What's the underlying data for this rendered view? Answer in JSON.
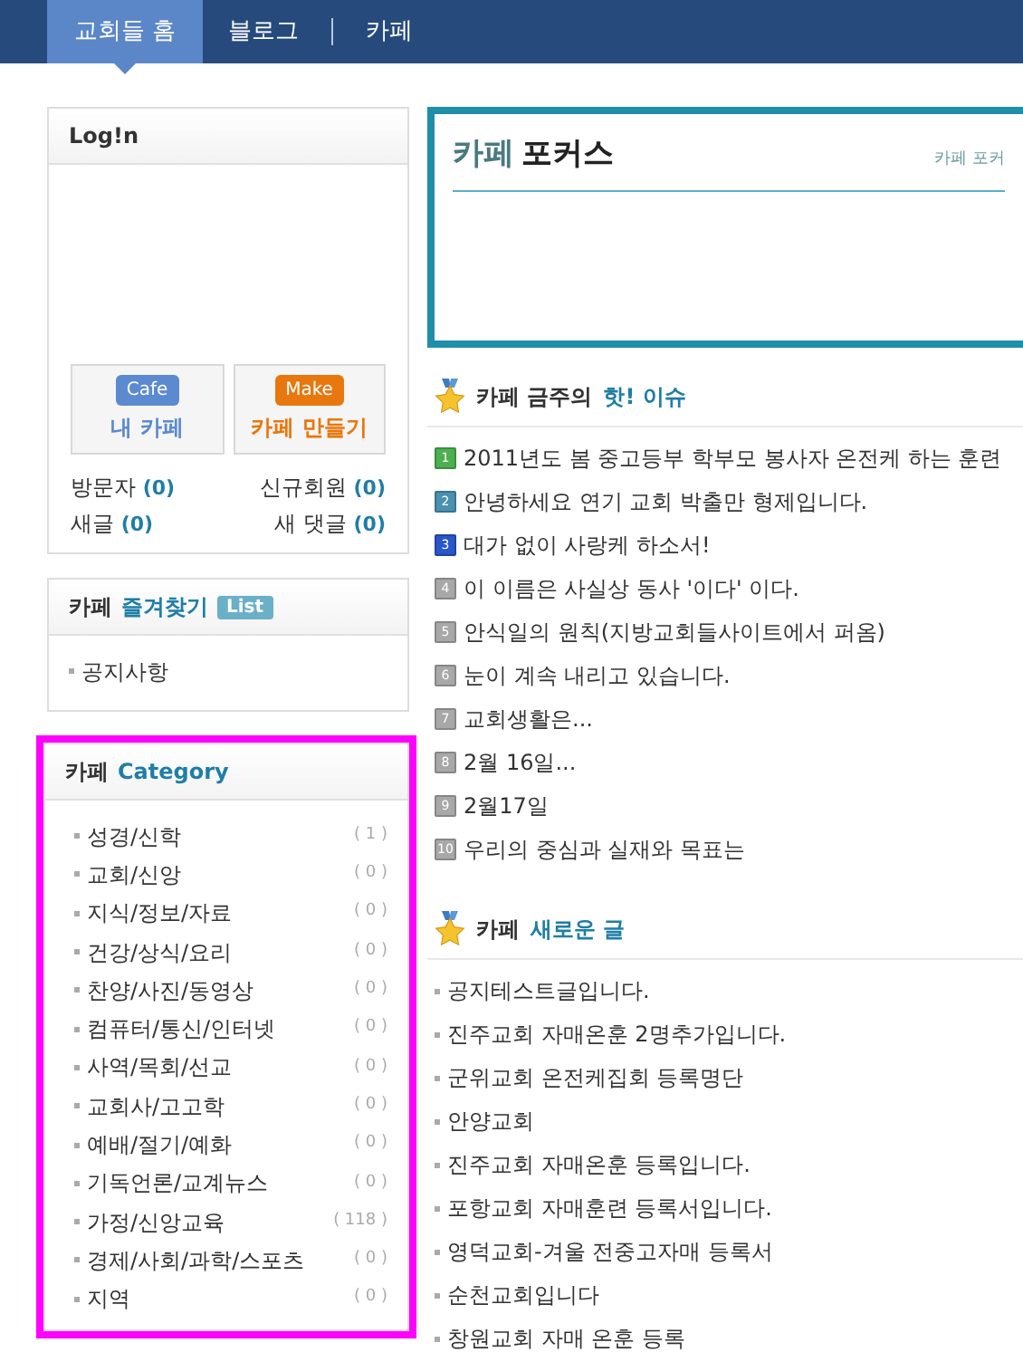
{
  "top_nav": [
    {
      "label": "교회들 홈",
      "selected": true
    },
    {
      "label": "블로그",
      "selected": false
    },
    {
      "label": "카페",
      "selected": false
    }
  ],
  "login": {
    "title": "Log!n",
    "buttons": [
      {
        "badge": "Cafe",
        "label": "내 카페",
        "color": "#5b8ad0"
      },
      {
        "badge": "Make",
        "label": "카페 만들기",
        "color": "#e8770e"
      }
    ],
    "stats": [
      {
        "label": "방문자",
        "count": "(0)"
      },
      {
        "label": "신규회원",
        "count": "(0)"
      },
      {
        "label": "새글",
        "count": "(0)"
      },
      {
        "label": "새 댓글",
        "count": "(0)"
      }
    ]
  },
  "favorites": {
    "prefix": "카페",
    "title": "즐겨찾기",
    "badge": "List",
    "items": [
      "공지사항"
    ]
  },
  "categories": {
    "prefix": "카페",
    "title": "Category",
    "highlighted": true,
    "items": [
      {
        "label": "성경/신학",
        "count": "( 1 )"
      },
      {
        "label": "교회/신앙",
        "count": "( 0 )"
      },
      {
        "label": "지식/정보/자료",
        "count": "( 0 )"
      },
      {
        "label": "건강/상식/요리",
        "count": "( 0 )"
      },
      {
        "label": "찬양/사진/동영상",
        "count": "( 0 )"
      },
      {
        "label": "컴퓨터/통신/인터넷",
        "count": "( 0 )"
      },
      {
        "label": "사역/목회/선교",
        "count": "( 0 )"
      },
      {
        "label": "교회사/고고학",
        "count": "( 0 )"
      },
      {
        "label": "예배/절기/예화",
        "count": "( 0 )"
      },
      {
        "label": "기독언론/교계뉴스",
        "count": "( 0 )"
      },
      {
        "label": "가정/신앙교육",
        "count": "( 118 )"
      },
      {
        "label": "경제/사회/과학/스포츠",
        "count": "( 0 )"
      },
      {
        "label": "지역",
        "count": "( 0 )"
      }
    ]
  },
  "focus": {
    "prefix": "카페",
    "title": "포커스",
    "link": "카페 포커"
  },
  "hot_issues": {
    "prefix": "카페 금주의",
    "highlight": "핫! 이슈",
    "items": [
      {
        "rank": "1",
        "color": "#4caf50",
        "title": "2011년도 봄 중고등부 학부모 봉사자 온전케 하는 훈련"
      },
      {
        "rank": "2",
        "color": "#4a90b0",
        "title": "안녕하세요 연기 교회 박출만 형제입니다."
      },
      {
        "rank": "3",
        "color": "#2a56c8",
        "title": "대가 없이 사랑케 하소서!"
      },
      {
        "rank": "4",
        "color": "#a8a8a8",
        "title": "이 이름은 사실상 동사 '이다' 이다."
      },
      {
        "rank": "5",
        "color": "#a8a8a8",
        "title": "안식일의 원칙(지방교회들사이트에서 퍼옴)"
      },
      {
        "rank": "6",
        "color": "#a8a8a8",
        "title": "눈이 계속 내리고 있습니다."
      },
      {
        "rank": "7",
        "color": "#a8a8a8",
        "title": "교회생활은..."
      },
      {
        "rank": "8",
        "color": "#a8a8a8",
        "title": "2월 16일..."
      },
      {
        "rank": "9",
        "color": "#a8a8a8",
        "title": "2월17일"
      },
      {
        "rank": "10",
        "color": "#a8a8a8",
        "title": "우리의 중심과 실재와 목표는"
      }
    ]
  },
  "new_posts": {
    "prefix": "카페",
    "highlight": "새로운 글",
    "items": [
      "공지테스트글입니다.",
      "진주교회 자매온훈 2명추가입니다.",
      "군위교회 온전케집회 등록명단",
      "안양교회",
      "진주교회 자매온훈 등록입니다.",
      "포항교회 자매훈련 등록서입니다.",
      "영덕교회-겨울 전중고자매 등록서",
      "순천교회입니다",
      "창원교회 자매 온훈 등록"
    ]
  }
}
